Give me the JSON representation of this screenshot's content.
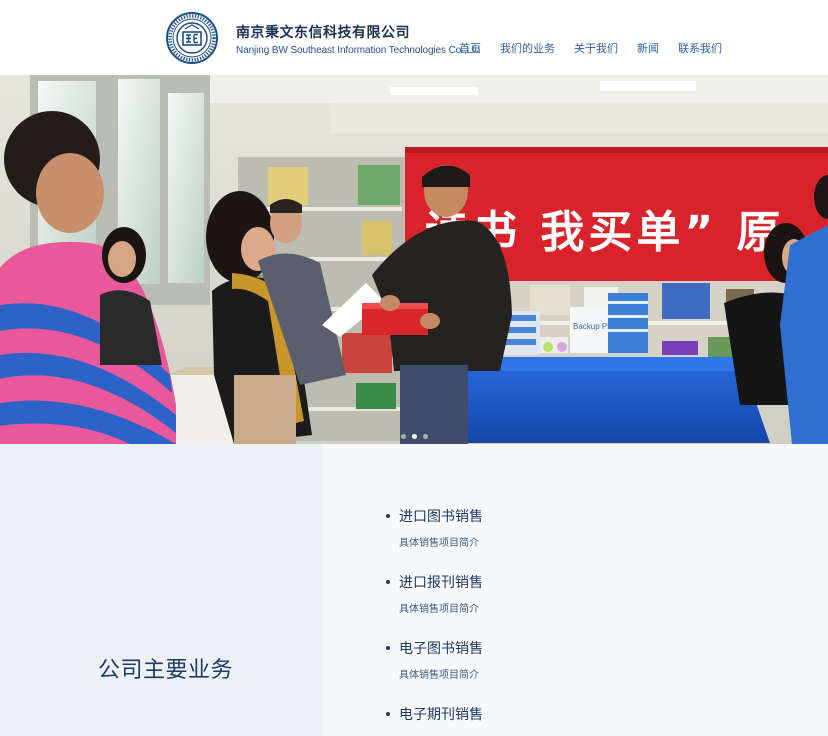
{
  "header": {
    "company_name_cn": "南京秉文东信科技有限公司",
    "company_name_en": "Nanjing BW Southeast Information Technologies Co.,Ltd",
    "logo_icon": "seal-logo",
    "logo_color": "#1f4e8c"
  },
  "nav": {
    "items": [
      {
        "label": "首页"
      },
      {
        "label": "我们的业务"
      },
      {
        "label": "关于我们"
      },
      {
        "label": "新闻"
      },
      {
        "label": "联系我们"
      }
    ]
  },
  "hero": {
    "banner_text": "读书 我买单” 原",
    "box_label": "Backup Plus",
    "slides_total": 3,
    "active_slide": 2
  },
  "business": {
    "title": "公司主要业务",
    "items": [
      {
        "name": "进口图书销售",
        "desc": "具体销售项目简介"
      },
      {
        "name": "进口报刊销售",
        "desc": "具体销售项目简介"
      },
      {
        "name": "电子图书销售",
        "desc": "具体销售项目简介"
      },
      {
        "name": "电子期刊销售",
        "desc": ""
      }
    ]
  },
  "colors": {
    "nav_link": "#2d5fa0",
    "title_navy": "#1e3a66",
    "banner_red": "#d8232a",
    "table_blue": "#1f57c4",
    "section_left_bg": "#ebf1f5"
  }
}
